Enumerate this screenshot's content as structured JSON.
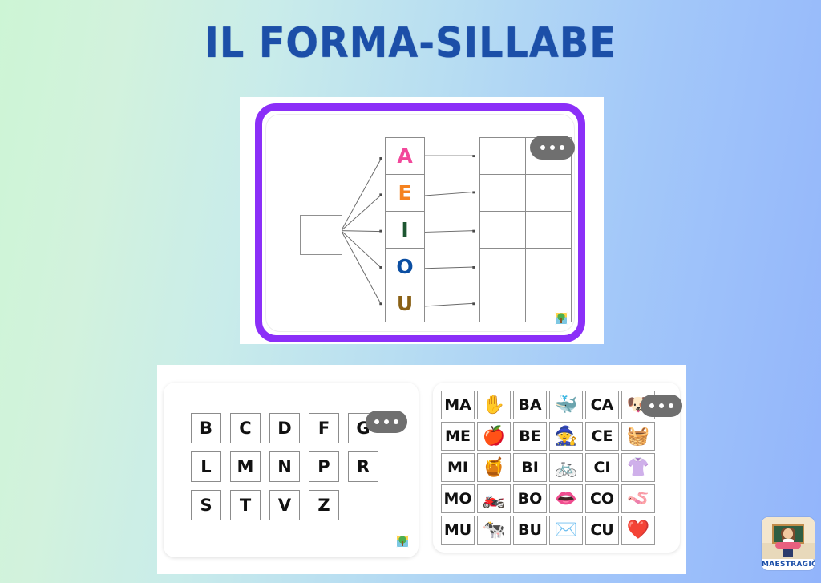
{
  "page": {
    "title": "IL FORMA-SILLABE",
    "background": {
      "from": "#cdf5d5",
      "to": "#92b4fb"
    },
    "accent_purple": "#8b2ff8"
  },
  "top_panel": {
    "menu_button": {
      "icon": "ellipsis-icon",
      "label": "•••"
    },
    "input_box": {
      "value": ""
    },
    "vowels": [
      {
        "letter": "A",
        "color": "#f2489b"
      },
      {
        "letter": "E",
        "color": "#f58220"
      },
      {
        "letter": "I",
        "color": "#1d5631"
      },
      {
        "letter": "O",
        "color": "#0b4ea2"
      },
      {
        "letter": "U",
        "color": "#8a6116"
      }
    ],
    "output_grid": {
      "rows": 5,
      "cols": 2,
      "cells": [
        [
          "",
          ""
        ],
        [
          "",
          ""
        ],
        [
          "",
          ""
        ],
        [
          "",
          ""
        ],
        [
          "",
          ""
        ]
      ]
    }
  },
  "consonant_panel": {
    "menu_button": {
      "icon": "ellipsis-icon",
      "label": "•••"
    },
    "rows": [
      [
        "B",
        "C",
        "D",
        "F",
        "G"
      ],
      [
        "L",
        "M",
        "N",
        "P",
        "R"
      ],
      [
        "S",
        "T",
        "V",
        "Z"
      ]
    ]
  },
  "syllable_panel": {
    "menu_button": {
      "icon": "ellipsis-icon",
      "label": "•••"
    },
    "columns": [
      {
        "type": "text",
        "cells": [
          "MA",
          "ME",
          "MI",
          "MO",
          "MU"
        ]
      },
      {
        "type": "picture",
        "cells": [
          "✋",
          "🍎",
          "🍯",
          "🏍️",
          "🐄"
        ],
        "names": [
          "hand-icon",
          "apple-icon",
          "honey-icon",
          "motorcycle-icon",
          "cow-icon"
        ]
      },
      {
        "type": "text",
        "cells": [
          "BA",
          "BE",
          "BI",
          "BO",
          "BU"
        ]
      },
      {
        "type": "picture",
        "cells": [
          "🐳",
          "🧙",
          "🚲",
          "👄",
          "✉️"
        ],
        "names": [
          "whale-icon",
          "witch-icon",
          "bicycle-icon",
          "mouth-icon",
          "envelope-icon"
        ]
      },
      {
        "type": "text",
        "cells": [
          "CA",
          "CE",
          "CI",
          "CO",
          "CU"
        ]
      },
      {
        "type": "picture",
        "cells": [
          "🐶",
          "🧺",
          "👚",
          "🪱",
          "❤️"
        ],
        "names": [
          "dog-icon",
          "basket-icon",
          "belt-icon",
          "tail-icon",
          "heart-icon"
        ]
      }
    ]
  },
  "brand": {
    "name": "MAESTRAGIÒ"
  }
}
